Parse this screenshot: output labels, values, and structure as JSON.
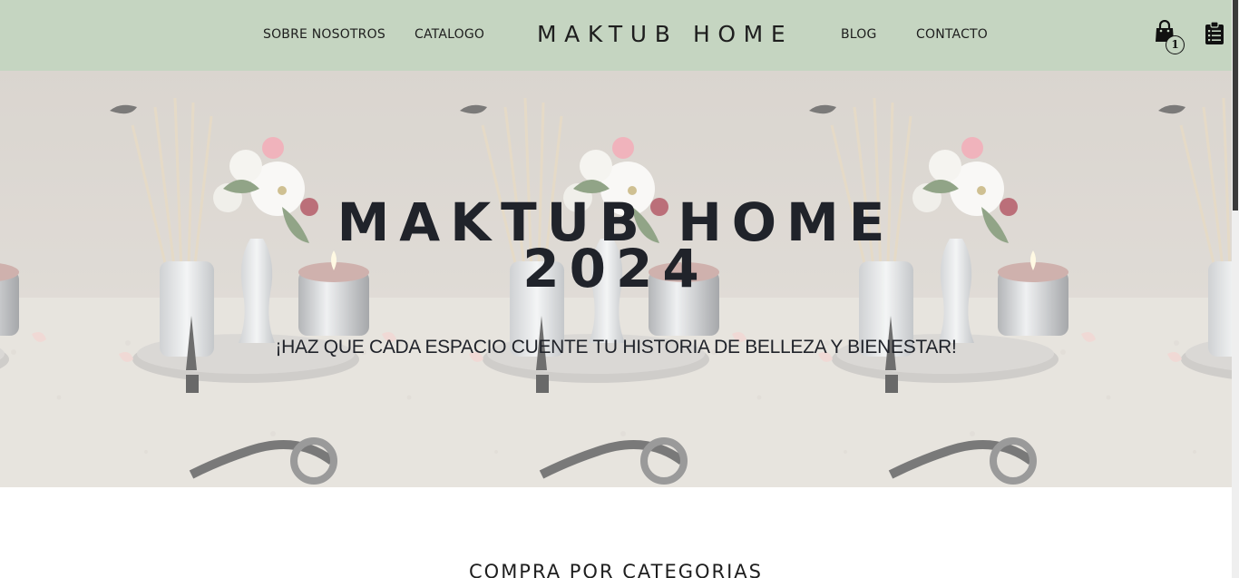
{
  "header": {
    "brand": "MAKTUB HOME",
    "nav_left": [
      "SOBRE NOSOTROS",
      "CATALOGO"
    ],
    "nav_right": [
      "BLOG",
      "CONTACTO"
    ],
    "cart_count": "1",
    "cart_icon": "shopping-bag-icon",
    "orders_icon": "clipboard-icon"
  },
  "hero": {
    "title_line1": "MAKTUB HOME",
    "title_line2": "2024",
    "subtitle": "¡HAZ QUE CADA ESPACIO CUENTE TU HISTORIA DE BELLEZA Y BIENESTAR!",
    "image_subject": "reed diffuser, vase with flowers and candle"
  },
  "section": {
    "title": "COMPRA POR CATEGORIAS"
  },
  "colors": {
    "nav_background": "#c5d5c1",
    "text": "#1e1e1e",
    "hero_text": "#20232a"
  }
}
